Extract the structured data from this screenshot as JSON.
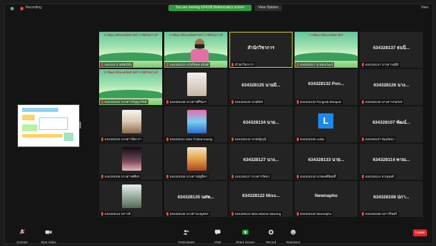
{
  "topbar": {
    "status_label": "Recording",
    "share_banner": "You are viewing 634328 Mathematics screen",
    "view_options": "View Options",
    "view_button": "View"
  },
  "tiles": [
    {
      "kind": "ppt",
      "slide": "การพัฒนาทักษะคณิตศาสตร์ การคิดวิเคราะห์",
      "label": "634328 นายทัศน์ชัย"
    },
    {
      "kind": "ppt-person",
      "slide": "การพัฒนาทักษะคณิตศาสตร์ การคิดวิเคราะห์",
      "label": "634328123 นายรัชพล อนันต์"
    },
    {
      "kind": "name-active",
      "name": "สำนักวิชาการ",
      "label": "สำนักวิชาการ"
    },
    {
      "kind": "ppt",
      "slide": "การพัฒนาทักษะคณิตศาสตร์",
      "label": "634328117 นายธนวัฒน์"
    },
    {
      "kind": "name",
      "name": "634328137 ธนนี...",
      "label": "634328137 นางสาวสุนีย์"
    },
    {
      "kind": "ppt",
      "slide": "การพัฒนาทักษะคณิตศาสตร์ การคิดวิเคราะห์",
      "label": "634328102 นางสาวกัญญารัตน์"
    },
    {
      "kind": "cat",
      "label": "634328138 นางสาวศิรินภา"
    },
    {
      "kind": "name",
      "name": "634328125 นายมิ...",
      "label": "634328125 นายมิตร"
    },
    {
      "kind": "name",
      "name": "634328132 Pon...",
      "label": "634328132 Pongsak Bhutpak"
    },
    {
      "kind": "name",
      "name": "634328126 นาง...",
      "label": "634328126 นางสาวกนกพร"
    },
    {
      "kind": "photo-a",
      "label": "634328103 นางสาวจิดาภา"
    },
    {
      "kind": "photo-b",
      "label": "634328111 Miss Thitirat Kaeng"
    },
    {
      "kind": "name",
      "name": "634328134 นาย...",
      "label": "634328134 นายณัฐวุฒิ"
    },
    {
      "kind": "L",
      "label": "634328106 Lalita"
    },
    {
      "kind": "name",
      "name": "634328107 พัฒน์...",
      "label": "634328107 พัฒน์ธนา"
    },
    {
      "kind": "photo-c",
      "label": "634328109 นางสาวศศิธร"
    },
    {
      "kind": "photo-d",
      "label": "634328108 นางสาวณัฐธิดา"
    },
    {
      "kind": "name",
      "name": "634328127 นาง...",
      "label": "634328127 นางสาวรัตนา"
    },
    {
      "kind": "name",
      "name": "634328133 นาย...",
      "label": "634328133 นายพงศ์พิสุทธิ์"
    },
    {
      "kind": "name",
      "name": "634328114 พาณ...",
      "label": "634328114 พาณุพงศ์"
    },
    {
      "kind": "photo-e",
      "label": "634328115 ปภาวดี"
    },
    {
      "kind": "name",
      "name": "634328135 นศพ...",
      "label": "634328135 นางสาวเบญจพร"
    },
    {
      "kind": "name",
      "name": "634328122 Miss...",
      "label": "634328122 Miss Wanna Nawong"
    },
    {
      "kind": "name",
      "name": "Newnapho",
      "label": "634328120 Newnapho"
    },
    {
      "kind": "name",
      "name": "634328108 ปภา...",
      "label": "634328108 ปภาวรินทร์"
    }
  ],
  "toolbar": {
    "unmute": "Unmute",
    "start_video": "Stop Video",
    "participants": "Participants",
    "participants_count": "28",
    "chat": "Chat",
    "share_screen": "Share Screen",
    "record": "Record",
    "reactions": "Reactions",
    "end": "Leave"
  },
  "colors": {
    "share_green": "#2e9d3f",
    "end_red": "#e02828",
    "active_outline": "#d4d60f"
  }
}
